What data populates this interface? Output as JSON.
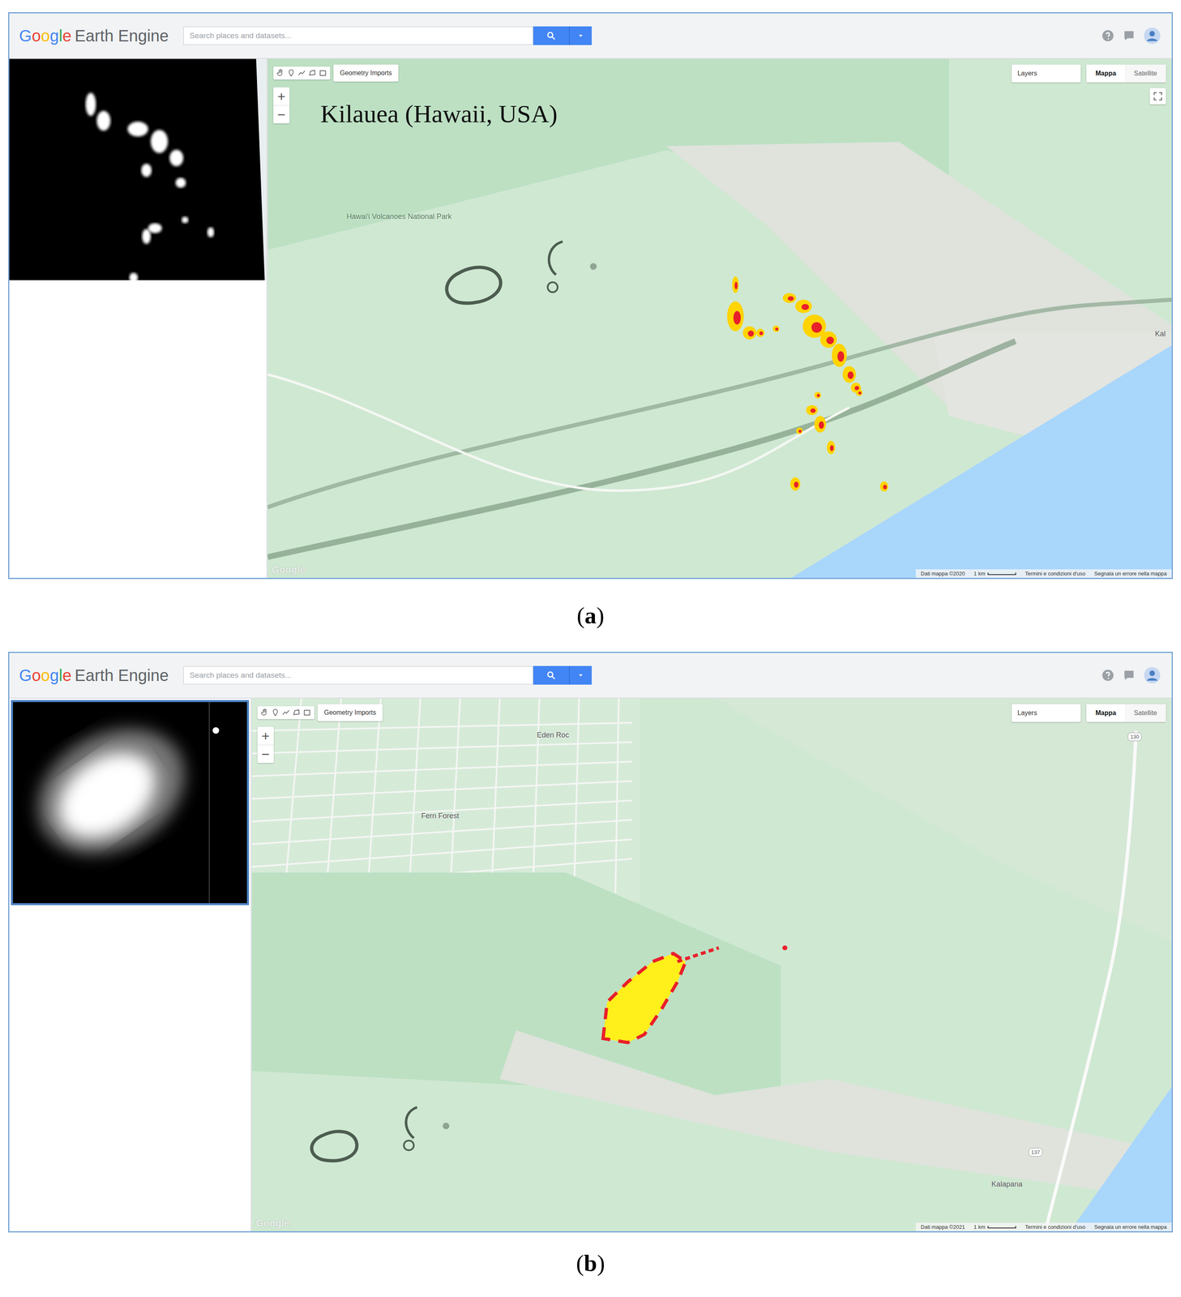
{
  "panels": [
    {
      "caption": {
        "open": "(",
        "letter": "a",
        "close": ")"
      },
      "header": {
        "logo": {
          "google": "Google",
          "product": "Earth Engine"
        },
        "search": {
          "placeholder": "Search places and datasets..."
        }
      },
      "map": {
        "title": "Kilauea (Hawaii, USA)",
        "toolbar": {
          "button": "Geometry Imports"
        },
        "zoom": [
          "+",
          "−"
        ],
        "layers": "Layers",
        "map_types": [
          {
            "label": "Mappa",
            "selected": true
          },
          {
            "label": "Satellite",
            "selected": false
          }
        ],
        "fullscreen_button": true,
        "labels": [
          {
            "text": "Hawai'i Volcanoes National Park",
            "kind": "park"
          },
          {
            "text": "Kal",
            "kind": "place"
          }
        ],
        "attribution": [
          {
            "text": "Dati mappa ©2020",
            "kind": "text"
          },
          {
            "text": "1 km",
            "kind": "scale"
          },
          {
            "text": "Termini e condizioni d'uso",
            "kind": "text"
          },
          {
            "text": "Segnala un errore nella mappa",
            "kind": "text"
          }
        ],
        "watermark": "Google"
      }
    },
    {
      "caption": {
        "open": "(",
        "letter": "b",
        "close": ")"
      },
      "header": {
        "logo": {
          "google": "Google",
          "product": "Earth Engine"
        },
        "search": {
          "placeholder": "Search places and datasets..."
        }
      },
      "map": {
        "toolbar": {
          "button": "Geometry Imports"
        },
        "zoom": [
          "+",
          "−"
        ],
        "layers": "Layers",
        "map_types": [
          {
            "label": "Mappa",
            "selected": true
          },
          {
            "label": "Satellite",
            "selected": false
          }
        ],
        "fullscreen_button": false,
        "labels": [
          {
            "text": "Eden Roc",
            "kind": "place"
          },
          {
            "text": "Fern Forest",
            "kind": "place"
          },
          {
            "text": "Kalapana",
            "kind": "place"
          },
          {
            "text": "130",
            "kind": "shield"
          },
          {
            "text": "137",
            "kind": "shield"
          }
        ],
        "attribution": [
          {
            "text": "Dati mappa ©2021",
            "kind": "text"
          },
          {
            "text": "1 km",
            "kind": "scale"
          },
          {
            "text": "Termini e condizioni d'uso",
            "kind": "text"
          },
          {
            "text": "Segnala un errore nella mappa",
            "kind": "text"
          }
        ],
        "watermark": "Google"
      }
    }
  ]
}
